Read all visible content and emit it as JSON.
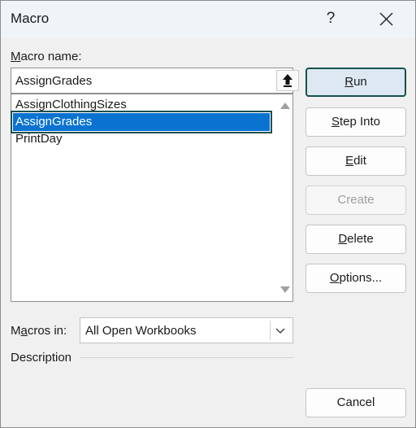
{
  "window": {
    "title": "Macro",
    "help_label": "?"
  },
  "macro_name": {
    "label_prefix": "",
    "label_hotkey": "M",
    "label_rest": "acro name:",
    "value": "AssignGrades"
  },
  "macro_list": {
    "items": [
      "AssignClothingSizes",
      "AssignGrades",
      "PrintDay"
    ],
    "selected_index": 1
  },
  "buttons": {
    "run": {
      "hotkey": "R",
      "rest": "un"
    },
    "step_into": {
      "hotkey": "S",
      "rest": "tep Into"
    },
    "edit": {
      "hotkey": "E",
      "rest": "dit"
    },
    "create": {
      "label": "Create"
    },
    "delete": {
      "hotkey": "D",
      "rest": "elete"
    },
    "options": {
      "hotkey": "O",
      "rest": "ptions..."
    },
    "cancel": {
      "label": "Cancel"
    }
  },
  "macros_in": {
    "label_pre": "M",
    "label_hotkey": "a",
    "label_rest": "cros in:",
    "value": "All Open Workbooks"
  },
  "description": {
    "label": "Description"
  },
  "icons": {
    "close": "close-icon",
    "upload": "upload-arrow-icon",
    "dropdown": "chevron-down-icon",
    "scroll_up": "scroll-up-arrow-icon",
    "scroll_down": "scroll-down-arrow-icon"
  },
  "colors": {
    "selection": "#0a73d1",
    "focus_border": "#17504f",
    "titlebar": "#eef4f8"
  }
}
